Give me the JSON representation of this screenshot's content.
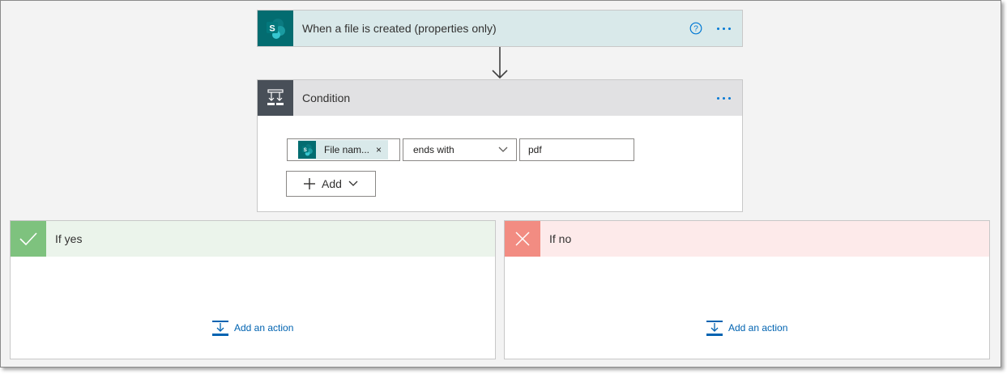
{
  "trigger": {
    "title": "When a file is created (properties only)",
    "icon": "sharepoint-icon",
    "header_color": "#d9e9ea",
    "icon_color": "#036c70"
  },
  "condition": {
    "title": "Condition",
    "icon": "condition-icon",
    "token_label": "File nam...",
    "token_remove": "×",
    "operator_value": "ends with",
    "compare_value": "pdf",
    "add_label": "Add"
  },
  "branches": {
    "yes": {
      "title": "If yes",
      "add_action_label": "Add an action",
      "accent": "#7ec27e"
    },
    "no": {
      "title": "If no",
      "add_action_label": "Add an action",
      "accent": "#f28c82"
    }
  },
  "colors": {
    "link": "#0063b1",
    "more_dots": "#0078d4"
  }
}
